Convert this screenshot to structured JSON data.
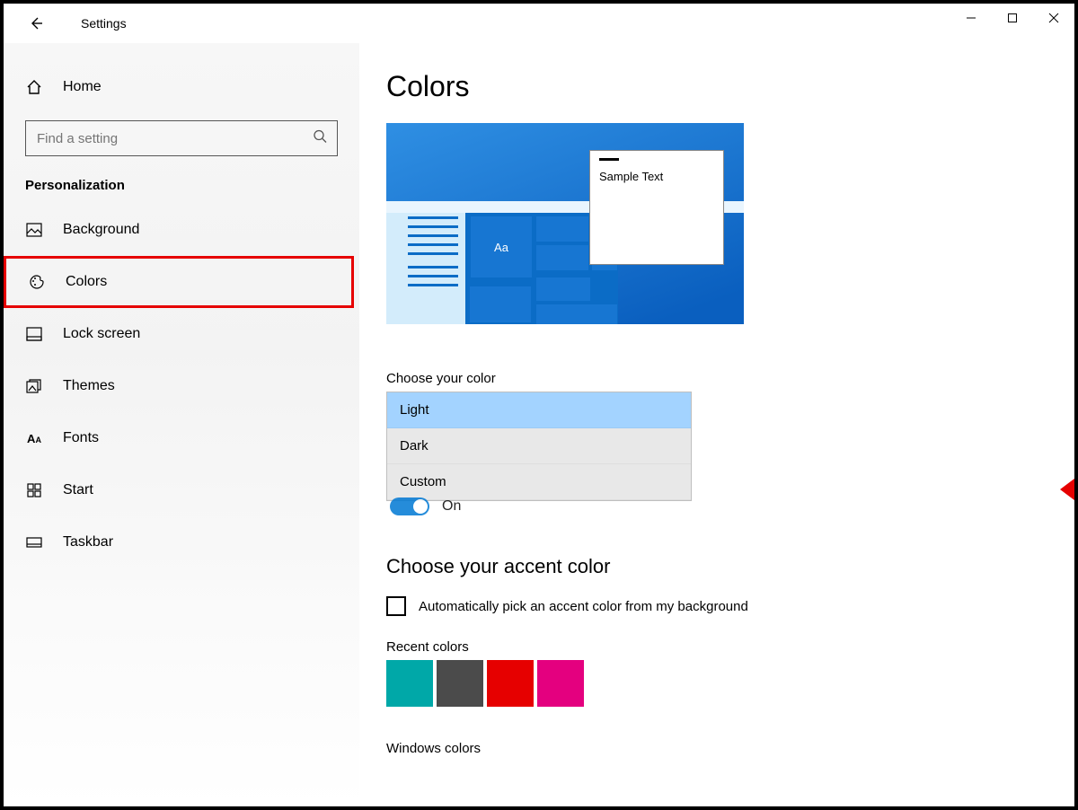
{
  "app": {
    "title": "Settings"
  },
  "sidebar": {
    "home": "Home",
    "search_placeholder": "Find a setting",
    "group": "Personalization",
    "items": [
      {
        "label": "Background"
      },
      {
        "label": "Colors"
      },
      {
        "label": "Lock screen"
      },
      {
        "label": "Themes"
      },
      {
        "label": "Fonts"
      },
      {
        "label": "Start"
      },
      {
        "label": "Taskbar"
      }
    ],
    "active_index": 1
  },
  "main": {
    "title": "Colors",
    "preview": {
      "sample_text": "Sample Text",
      "sample_aa": "Aa"
    },
    "choose_color_label": "Choose your color",
    "color_options": [
      "Light",
      "Dark",
      "Custom"
    ],
    "color_selected_index": 0,
    "toggle_peek_label": "On",
    "accent_heading": "Choose your accent color",
    "auto_pick_label": "Automatically pick an accent color from my background",
    "recent_colors_label": "Recent colors",
    "recent_colors": [
      "#00a8a8",
      "#4b4b4b",
      "#e60000",
      "#e4007f"
    ],
    "windows_colors_label": "Windows colors"
  },
  "annotation": {
    "colors_item_highlight": "#e60000",
    "arrow_color": "#e60000"
  }
}
